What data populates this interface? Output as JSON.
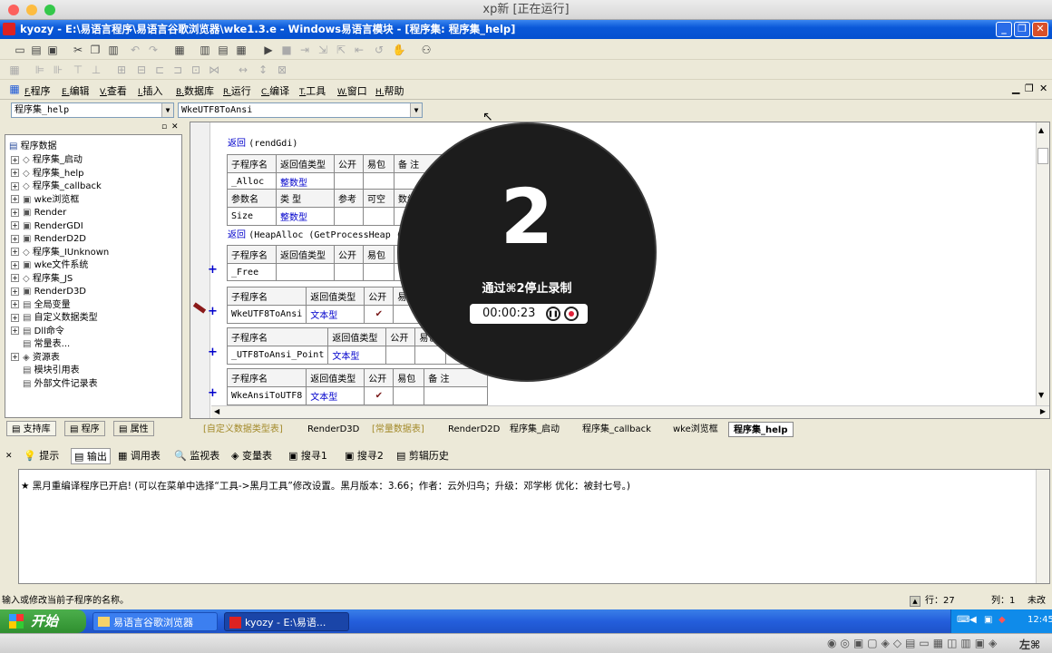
{
  "mac": {
    "title": "xp新 [正在运行]"
  },
  "window": {
    "title": "kyozy - E:\\易语言程序\\易语言谷歌浏览器\\wke1.3.e - Windows易语言模块 - [程序集: 程序集_help]"
  },
  "menu": [
    {
      "key": "F.",
      "label": "程序"
    },
    {
      "key": "E.",
      "label": "编辑"
    },
    {
      "key": "V.",
      "label": "查看"
    },
    {
      "key": "I.",
      "label": "插入"
    },
    {
      "key": "B.",
      "label": "数据库"
    },
    {
      "key": "R.",
      "label": "运行"
    },
    {
      "key": "C.",
      "label": "编译"
    },
    {
      "key": "T.",
      "label": "工具"
    },
    {
      "key": "W.",
      "label": "窗口"
    },
    {
      "key": "H.",
      "label": "帮助"
    }
  ],
  "combos": {
    "left": "程序集_help",
    "right": "WkeUTF8ToAnsi"
  },
  "tree": {
    "root": "程序数据",
    "items": [
      "程序集_启动",
      "程序集_help",
      "程序集_callback",
      "wke浏览框",
      "Render",
      "RenderGDI",
      "RenderD2D",
      "程序集_IUnknown",
      "wke文件系统",
      "程序集_JS",
      "RenderD3D",
      "全局变量",
      "自定义数据类型",
      "Dll命令",
      "常量表...",
      "资源表",
      "模块引用表",
      "外部文件记录表"
    ]
  },
  "left_tabs": [
    "支持库",
    "程序",
    "属性"
  ],
  "code": {
    "return1": "返回",
    "return1_arg": "(rendGdi)",
    "hdr": {
      "name": "子程序名",
      "rettype": "返回值类型",
      "public": "公开",
      "easy": "易包",
      "note": "备 注",
      "param": "参数名",
      "type": "类 型",
      "ref": "参考",
      "opt": "可空",
      "arr": "数组"
    },
    "alloc": {
      "name": "_Alloc",
      "ret": "整数型",
      "param": "Size",
      "ptype": "整数型"
    },
    "return2": "返回",
    "return2_arg": "(HeapAlloc (GetProcessHeap (), 0, Size))",
    "subs": [
      {
        "name": "_Free",
        "ret": "",
        "pub": ""
      },
      {
        "name": "WkeUTF8ToAnsi",
        "ret": "文本型",
        "pub": "✔"
      },
      {
        "name": "_UTF8ToAnsi_Point",
        "ret": "文本型",
        "pub": ""
      },
      {
        "name": "WkeAnsiToUTF8",
        "ret": "文本型",
        "pub": "✔"
      }
    ]
  },
  "doc_tabs": [
    "[自定义数据类型表]",
    "RenderD3D",
    "[常量数据表]",
    "RenderD2D",
    "程序集_启动",
    "程序集_callback",
    "wke浏览框",
    "程序集_help"
  ],
  "bottom_tabs": [
    "提示",
    "输出",
    "调用表",
    "监视表",
    "变量表",
    "搜寻1",
    "搜寻2",
    "剪辑历史"
  ],
  "output": "★ 黑月重编译程序已开启! (可以在菜单中选择“工具->黑月工具”修改设置。黑月版本：3.66；作者：云外归鸟；升级：邓学彬 优化：被封七号。)",
  "status": {
    "hint": "输入或修改当前子程序的名称。",
    "row_label": "行：",
    "row": "27",
    "col_label": "列：1",
    "mode": "未改"
  },
  "taskbar": {
    "start": "开始",
    "btn1": "易语言谷歌浏览器",
    "btn2": "kyozy - E:\\易语...",
    "clock": "12:45"
  },
  "recording": {
    "countdown": "2",
    "hint": "通过⌘2停止录制",
    "time": "00:00:23"
  }
}
